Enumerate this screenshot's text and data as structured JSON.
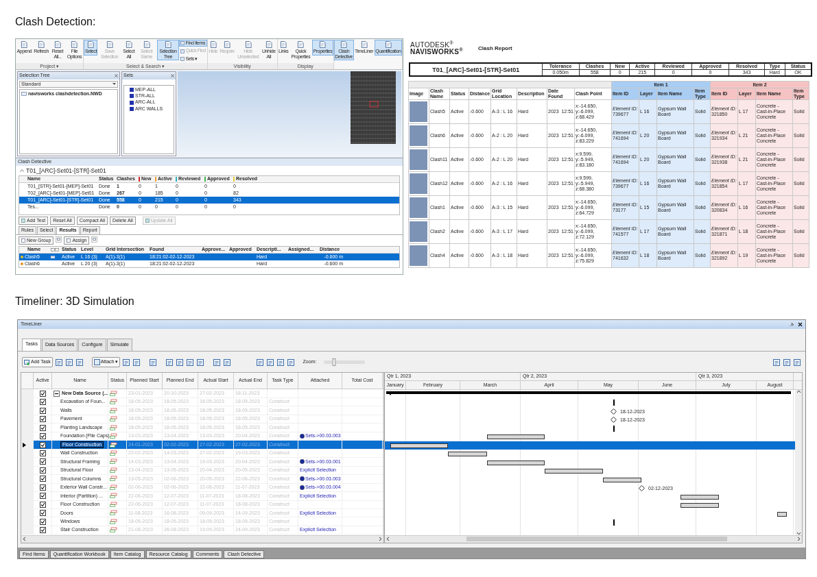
{
  "clash_section": {
    "heading": "Clash Detection:"
  },
  "ribbon": {
    "groups": [
      {
        "label": "Project ▾",
        "buttons": [
          {
            "kind": "large",
            "label": "Append",
            "selected": false,
            "disabled": false
          },
          {
            "kind": "large",
            "label": "Refresh",
            "selected": false,
            "disabled": false
          },
          {
            "kind": "large",
            "label": "Reset All...",
            "selected": false,
            "disabled": false
          },
          {
            "kind": "large",
            "label": "File Options",
            "selected": false,
            "disabled": false
          }
        ]
      },
      {
        "label": "Select & Search ▾",
        "buttons": [
          {
            "kind": "large",
            "label": "Select",
            "selected": true,
            "disabled": false
          },
          {
            "kind": "large",
            "label": "Save Selection",
            "selected": false,
            "disabled": true
          },
          {
            "kind": "large",
            "label": "Select All",
            "selected": false,
            "disabled": false
          },
          {
            "kind": "large",
            "label": "Select Same",
            "selected": false,
            "disabled": true
          },
          {
            "kind": "large",
            "label": "Selection Tree",
            "selected": true,
            "disabled": false
          },
          {
            "kind": "small",
            "label": "Find Items",
            "selected": true,
            "disabled": false
          },
          {
            "kind": "small",
            "label": "Quick Find",
            "selected": false,
            "disabled": true
          },
          {
            "kind": "small",
            "label": "Sets ▾",
            "selected": false,
            "disabled": false
          }
        ]
      },
      {
        "label": "Visibility",
        "buttons": [
          {
            "kind": "large",
            "label": "Hide",
            "selected": false,
            "disabled": true
          },
          {
            "kind": "large",
            "label": "Require",
            "selected": false,
            "disabled": true
          },
          {
            "kind": "large",
            "label": "Hide Unselected",
            "selected": false,
            "disabled": true
          },
          {
            "kind": "large",
            "label": "Unhide All",
            "selected": false,
            "disabled": false
          }
        ]
      },
      {
        "label": "Display",
        "buttons": [
          {
            "kind": "large",
            "label": "Links",
            "selected": false,
            "disabled": false
          },
          {
            "kind": "large",
            "label": "Quick Properties",
            "selected": false,
            "disabled": false
          },
          {
            "kind": "large",
            "label": "Properties",
            "selected": true,
            "disabled": false
          }
        ]
      },
      {
        "buttons": [
          {
            "kind": "large",
            "label": "Clash Detective",
            "selected": true,
            "disabled": false
          },
          {
            "kind": "large",
            "label": "TimeLiner",
            "selected": false,
            "disabled": false
          },
          {
            "kind": "large",
            "label": "Quantification",
            "selected": true,
            "disabled": false
          }
        ]
      }
    ]
  },
  "selection_tree": {
    "title": "Selection Tree",
    "dropdown": "Standard",
    "items": [
      {
        "label": "navisworks clashdetection.NWD"
      }
    ]
  },
  "sets_panel": {
    "title": "Sets",
    "items": [
      {
        "label": "MEP-ALL"
      },
      {
        "label": "STR-ALL"
      },
      {
        "label": "ARC-ALL"
      },
      {
        "label": "ARC WALLS"
      }
    ]
  },
  "clash_detective": {
    "title": "Clash Detective",
    "test_name": "T01_[ARC]-Set01-[STR]-Set01",
    "tests": {
      "columns": [
        {
          "label": "Name"
        },
        {
          "label": "Status"
        },
        {
          "label": "Clashes"
        },
        {
          "label": "New",
          "color": "#d9262b"
        },
        {
          "label": "Active",
          "color": "#f0a030"
        },
        {
          "label": "Reviewed",
          "color": "#2ab5c5"
        },
        {
          "label": "Approved",
          "color": "#3cb850"
        },
        {
          "label": "Resolved",
          "color": "#e8d030"
        }
      ],
      "rows": [
        {
          "cells": [
            "T01_[STR]-Set01-[MEP]-Set01",
            "Done",
            "1",
            "0",
            "1",
            "0",
            "0",
            "0"
          ],
          "selected": false
        },
        {
          "cells": [
            "T02_[ARC]-Set01-[MEP]-Set01",
            "Done",
            "267",
            "0",
            "185",
            "0",
            "0",
            "82"
          ],
          "selected": false
        },
        {
          "cells": [
            "T01_[ARC]-Set01-[STR]-Set01",
            "Done",
            "558",
            "0",
            "215",
            "0",
            "0",
            "343"
          ],
          "selected": true
        },
        {
          "cells": [
            "Tes...",
            "Done",
            "0",
            "0",
            "0",
            "0",
            "0",
            "0"
          ],
          "selected": false
        }
      ]
    },
    "buttons": [
      {
        "label": "Add Test",
        "disabled": false
      },
      {
        "label": "Reset All",
        "disabled": false
      },
      {
        "label": "Compact All",
        "disabled": false
      },
      {
        "label": "Delete All",
        "disabled": false
      },
      {
        "label": "Update All",
        "disabled": true
      }
    ],
    "tabs": [
      {
        "label": "Rules",
        "selected": false
      },
      {
        "label": "Select",
        "selected": false
      },
      {
        "label": "Results",
        "selected": true
      },
      {
        "label": "Report",
        "selected": false
      }
    ],
    "toolbar": [
      {
        "label": "New Group"
      },
      {
        "label": "Assign"
      }
    ],
    "results": {
      "columns": [
        "Name",
        "Status",
        "Level",
        "Grid Intersection",
        "Found",
        "Approve...",
        "Approved",
        "Descripti...",
        "Assigned...",
        "Distance"
      ],
      "rows": [
        {
          "name": "Clash5",
          "color": "#e8c020",
          "status": "Active",
          "level": "L 16 (3)",
          "grid": "A(1)-3(1)",
          "found": "18:21:02-02-12-2023",
          "description": "Hard",
          "distance": "-0.600 m",
          "selected": true
        },
        {
          "name": "Clash6",
          "color": "#e89020",
          "status": "Active",
          "level": "L 20 (3)",
          "grid": "A(1)-3(1)",
          "found": "18:21:02-02-12-2023",
          "description": "Hard",
          "distance": "-0.600 m",
          "selected": false
        }
      ]
    }
  },
  "report": {
    "logo_top": "AUTODESK$^{®}$",
    "logo_bottom": "NAVISWORKS$^{®}$",
    "title": "Clash Report",
    "summary": {
      "test": "T01_[ARC]-Set01-[STR]-Set01",
      "columns": [
        "Tolerance",
        "Clashes",
        "New",
        "Active",
        "Reviewed",
        "Approved",
        "Resolved",
        "Type",
        "Status"
      ],
      "values": [
        "0.050m",
        "558",
        "0",
        "215",
        "0",
        "0",
        "343",
        "Hard",
        "OK"
      ]
    },
    "groups": [
      {
        "label": "Item 1",
        "color": "#a9cdf3"
      },
      {
        "label": "Item 2",
        "color": "#f5c3c3"
      }
    ],
    "columns": [
      "Image",
      "Clash Name",
      "Status",
      "Distance",
      "Grid Location",
      "Description",
      "Date Found",
      "Clash Point",
      "Item ID",
      "Layer",
      "Item Name",
      "Item Type",
      "Item ID",
      "Layer",
      "Item Name",
      "Item Type"
    ],
    "rows": [
      {
        "clash_name": "Clash5",
        "status": "Active",
        "distance": "-0.600",
        "grid_location": "A-3 : L 16",
        "description": "Hard",
        "date": "2023",
        "time": "12:51",
        "clash_point": "x:-14.650, y:-6.099, z:68.429",
        "item1": {
          "id": "*Element ID:* 739677",
          "layer": "L 16",
          "name": "Gypsum Wall Board",
          "type": "Solid"
        },
        "item2": {
          "id": "*Element ID:* 321850",
          "layer": "L 17",
          "name": "Concrete - Cast-in-Place Concrete",
          "type": "Solid"
        }
      },
      {
        "clash_name": "Clash6",
        "status": "Active",
        "distance": "-0.600",
        "grid_location": "A-2 : L 20",
        "description": "Hard",
        "date": "2023",
        "time": "12:51",
        "clash_point": "x:-14.650, y:-6.099, z:83.229",
        "item1": {
          "id": "*Element ID:* 741694",
          "layer": "L 20",
          "name": "Gypsum Wall Board",
          "type": "Solid"
        },
        "item2": {
          "id": "*Element ID:* 321934",
          "layer": "L 21",
          "name": "Concrete - Cast-in-Place Concrete",
          "type": "Solid"
        }
      },
      {
        "clash_name": "Clash11",
        "status": "Active",
        "distance": "-0.600",
        "grid_location": "A-2 : L 20",
        "description": "Hard",
        "date": "2023",
        "time": "12:51",
        "clash_point": "x:9.599, y:-5.949, z:83.180",
        "item1": {
          "id": "*Element ID:* 741694",
          "layer": "L 20",
          "name": "Gypsum Wall Board",
          "type": "Solid"
        },
        "item2": {
          "id": "*Element ID:* 321938",
          "layer": "L 21",
          "name": "Concrete - Cast-in-Place Concrete",
          "type": "Solid"
        }
      },
      {
        "clash_name": "Clash12",
        "status": "Active",
        "distance": "-0.600",
        "grid_location": "A-2 : L 16",
        "description": "Hard",
        "date": "2023",
        "time": "12:51",
        "clash_point": "x:9.599, y:-5.949, z:68.380",
        "item1": {
          "id": "*Element ID:* 739677",
          "layer": "L 16",
          "name": "Gypsum Wall Board",
          "type": "Solid"
        },
        "item2": {
          "id": "*Element ID:* 321854",
          "layer": "L 17",
          "name": "Concrete - Cast-in-Place Concrete",
          "type": "Solid"
        }
      },
      {
        "clash_name": "Clash1",
        "status": "Active",
        "distance": "-0.600",
        "grid_location": "A-3 : L 15",
        "description": "Hard",
        "date": "2023",
        "time": "12:51",
        "clash_point": "x:-14.650, y:-6.099, z:64.729",
        "item1": {
          "id": "*Element ID:* 73177",
          "layer": "L 15",
          "name": "Gypsum Wall Board",
          "type": "Solid"
        },
        "item2": {
          "id": "*Element ID:* 320834",
          "layer": "L 16",
          "name": "Concrete - Cast-in-Place Concrete",
          "type": "Solid"
        }
      },
      {
        "clash_name": "Clash2",
        "status": "Active",
        "distance": "-0.600",
        "grid_location": "A-3 : L 17",
        "description": "Hard",
        "date": "2023",
        "time": "12:51",
        "clash_point": "x:-14.650, y:-6.099, z:72.129",
        "item1": {
          "id": "*Element ID:* 741577",
          "layer": "L 17",
          "name": "Gypsum Wall Board",
          "type": "Solid"
        },
        "item2": {
          "id": "*Element ID:* 321871",
          "layer": "L 18",
          "name": "Concrete - Cast-in-Place Concrete",
          "type": "Solid"
        }
      },
      {
        "clash_name": "Clash4",
        "status": "Active",
        "distance": "-0.600",
        "grid_location": "A-3 : L 18",
        "description": "Hard",
        "date": "2023",
        "time": "12:51",
        "clash_point": "x:-14.650, y:-6.099, z:75.829",
        "item1": {
          "id": "*Element ID:* 741632",
          "layer": "L 18",
          "name": "Gypsum Wall Board",
          "type": "Solid"
        },
        "item2": {
          "id": "*Element ID:* 321892",
          "layer": "L 19",
          "name": "Concrete - Cast-in-Place Concrete",
          "type": "Solid"
        }
      }
    ]
  },
  "timeliner_section": {
    "heading": "Timeliner: 3D Simulation"
  },
  "timeliner": {
    "title": "TimeLiner",
    "tabs": [
      {
        "label": "Tasks",
        "selected": true
      },
      {
        "label": "Data Sources",
        "selected": false
      },
      {
        "label": "Configure",
        "selected": false
      },
      {
        "label": "Simulate",
        "selected": false
      }
    ],
    "add_task": "Add Task",
    "attach": "Attach ▾",
    "zoom_label": "Zoom:",
    "zoom_slider": {
      "level": 0.25
    },
    "columns": [
      "Active",
      "Name",
      "Status",
      "Planned Start",
      "Planned End",
      "Actual Start",
      "Actual End",
      "Task Type",
      "Attached",
      "Total Cost"
    ],
    "tasks": [
      {
        "active": true,
        "name": "New Data Source (...",
        "planned_start": "23-01-2023",
        "planned_end": "20-10-2023",
        "actual_start": "27-02-2023",
        "actual_end": "18-11-2023",
        "expanded": true,
        "selected": false,
        "children": [
          {
            "active": true,
            "name": "Excavation of Foun...",
            "planned_start": "18-05-2023",
            "planned_end": "18-05-2023",
            "actual_start": "18-05-2023",
            "actual_end": "18-05-2023",
            "task_type": "Construct",
            "selected": false
          },
          {
            "active": true,
            "name": "Walls",
            "planned_start": "18-05-2023",
            "planned_end": "18-05-2023",
            "actual_start": "18-05-2023",
            "actual_end": "18-05-2023",
            "task_type": "Construct",
            "selected": false,
            "gantt_label": "18-12-2023"
          },
          {
            "active": true,
            "name": "Pavement",
            "planned_start": "18-05-2023",
            "planned_end": "18-05-2023",
            "actual_start": "18-05-2023",
            "actual_end": "18-05-2023",
            "task_type": "Construct",
            "selected": false,
            "gantt_label": "18-12-2023"
          },
          {
            "active": true,
            "name": "Planting Landscape",
            "planned_start": "18-05-2023",
            "planned_end": "18-05-2023",
            "actual_start": "18-05-2023",
            "actual_end": "18-05-2023",
            "task_type": "Construct",
            "selected": false
          },
          {
            "active": true,
            "name": "Foundation (Pile Caps)",
            "planned_start": "13-03-2023",
            "planned_end": "13-04-2023",
            "actual_start": "13-03-2023",
            "actual_end": "20-04-2023",
            "task_type": "Construct",
            "attached": {
              "kind": "set",
              "text": "Sets->00.03.003"
            },
            "selected": false
          },
          {
            "active": true,
            "name": "Floor Construction",
            "planned_start": "24-01-2023",
            "planned_end": "02-02-2023",
            "actual_start": "27-02-2023",
            "actual_end": "27-02-2023",
            "task_type": "Construct",
            "selected": true
          },
          {
            "active": true,
            "name": "Wall Construction",
            "planned_start": "22-02-2023",
            "planned_end": "14-03-2023",
            "actual_start": "27-02-2023",
            "actual_end": "19-03-2023",
            "task_type": "Construct",
            "selected": false
          },
          {
            "active": true,
            "name": "Structural Framing",
            "planned_start": "14-03-2023",
            "planned_end": "13-04-2023",
            "actual_start": "19-03-2023",
            "actual_end": "20-04-2023",
            "task_type": "Construct",
            "attached": {
              "kind": "set",
              "text": "Sets->00.03.001"
            },
            "selected": false
          },
          {
            "active": true,
            "name": "Structural Floor",
            "planned_start": "13-04-2023",
            "planned_end": "13-05-2023",
            "actual_start": "20-04-2023",
            "actual_end": "20-05-2023",
            "task_type": "Construct",
            "attached": {
              "kind": "explicit",
              "text": "Explicit Selection"
            },
            "selected": false
          },
          {
            "active": true,
            "name": "Structural Columns",
            "planned_start": "13-05-2023",
            "planned_end": "02-06-2023",
            "actual_start": "20-05-2023",
            "actual_end": "22-06-2023",
            "task_type": "Construct",
            "attached": {
              "kind": "set",
              "text": "Sets->00.03.003"
            },
            "selected": false
          },
          {
            "active": true,
            "name": "Exterior Wall Constr...",
            "planned_start": "02-06-2023",
            "planned_end": "02-06-2023",
            "actual_start": "22-06-2023",
            "actual_end": "11-07-2023",
            "task_type": "Construct",
            "attached": {
              "kind": "set",
              "text": "Sets->00.03.004"
            },
            "selected": false,
            "gantt_label": "02-12-2023"
          },
          {
            "active": true,
            "name": "Interior (Partition) ...",
            "planned_start": "22-06-2023",
            "planned_end": "12-07-2023",
            "actual_start": "11-07-2023",
            "actual_end": "18-08-2023",
            "task_type": "Construct",
            "attached": {
              "kind": "explicit",
              "text": "Explicit Selection"
            },
            "selected": false
          },
          {
            "active": true,
            "name": "Floor Construction",
            "planned_start": "22-06-2023",
            "planned_end": "12-07-2023",
            "actual_start": "11-07-2023",
            "actual_end": "18-08-2023",
            "task_type": "Construct",
            "selected": false
          },
          {
            "active": true,
            "name": "Doors",
            "planned_start": "11-08-2023",
            "planned_end": "16-08-2023",
            "actual_start": "09-09-2023",
            "actual_end": "14-09-2023",
            "task_type": "Construct",
            "attached": {
              "kind": "explicit",
              "text": "Explicit Selection"
            },
            "selected": false
          },
          {
            "active": true,
            "name": "Windows",
            "planned_start": "18-05-2023",
            "planned_end": "18-05-2023",
            "actual_start": "18-05-2023",
            "actual_end": "18-05-2023",
            "task_type": "Construct",
            "selected": false
          },
          {
            "active": true,
            "name": "Stair Construction",
            "planned_start": "21-08-2023",
            "planned_end": "26-08-2023",
            "actual_start": "19-09-2023",
            "actual_end": "24-09-2023",
            "task_type": "Construct",
            "attached": {
              "kind": "explicit",
              "text": "Explicit Selection"
            },
            "selected": false
          }
        ]
      }
    ],
    "gantt": {
      "quarters": [
        "Qtr 1, 2023",
        "Qtr 2, 2023",
        "Qtr 3, 2023"
      ],
      "months": [
        "January",
        "February",
        "March",
        "April",
        "May",
        "June",
        "July",
        "August"
      ]
    },
    "bottom_tabs": [
      "Find Items",
      "Quantification Workbook",
      "Item Catalog",
      "Resource Catalog",
      "Comments",
      "Clash Detective"
    ]
  }
}
